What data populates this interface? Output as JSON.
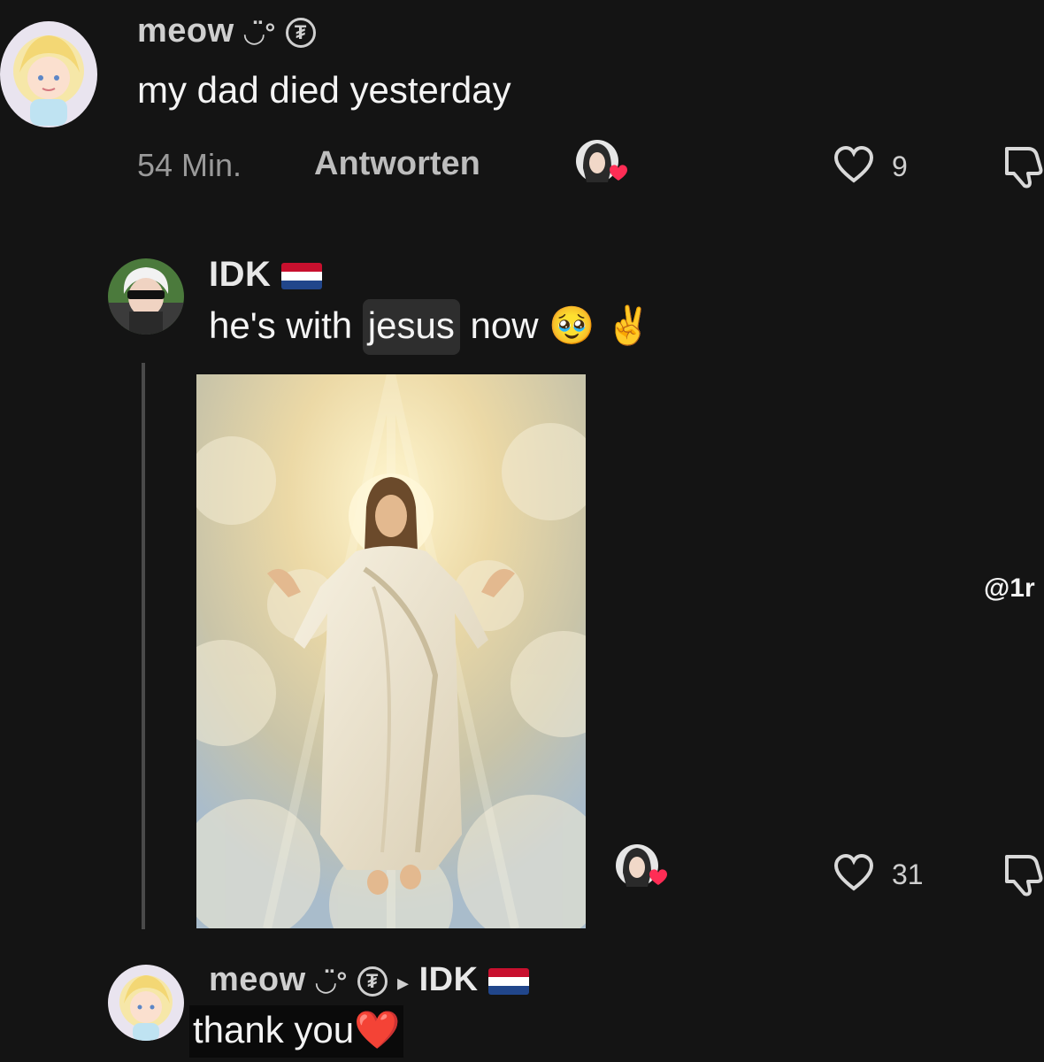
{
  "comments": [
    {
      "username": "meow",
      "username_suffix": "◡̈°",
      "text": "my dad died yesterday",
      "time": "54 Min.",
      "reply_label": "Antworten",
      "likes": "9"
    },
    {
      "username": "IDK",
      "flag": "netherlands-flag",
      "text_before": "he's with",
      "text_highlight": "jesus",
      "text_after": "now",
      "emoji_1": "🥹",
      "emoji_2": "✌️",
      "likes": "31",
      "image": "jesus-in-clouds-image"
    },
    {
      "username": "meow",
      "username_suffix": "◡̈°",
      "reply_to_arrow": "▸",
      "reply_to": "IDK",
      "text": "thank you",
      "emoji": "❤️"
    }
  ],
  "watermark": "@1r",
  "colors": {
    "background": "#141414",
    "heart_red": "#ff2d55",
    "flag_red": "#c8102e",
    "flag_blue": "#21468b"
  }
}
